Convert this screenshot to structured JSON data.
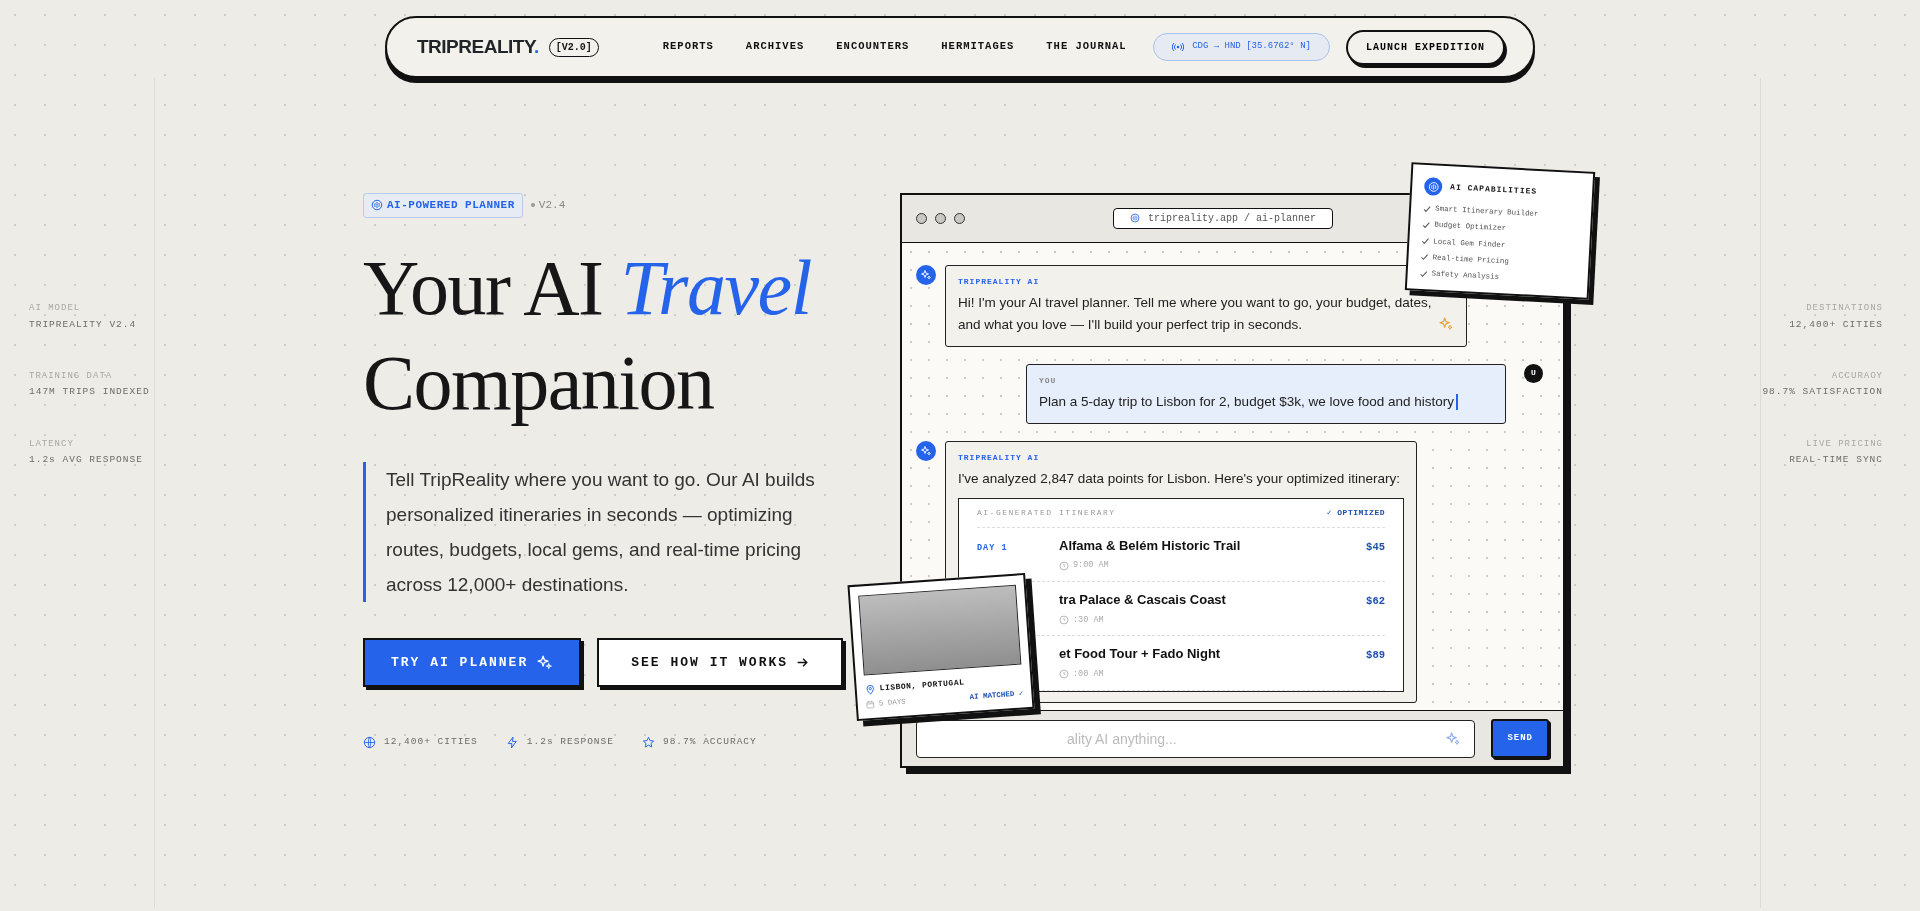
{
  "nav": {
    "brand": "TRIPREALITY",
    "brand_dot": ".",
    "version": "[V2.0]",
    "links": [
      "REPORTS",
      "ARCHIVES",
      "ENCOUNTERS",
      "HERMITAGES",
      "THE JOURNAL"
    ],
    "route": "CDG → HND [35.6762° N]",
    "cta": "LAUNCH EXPEDITION"
  },
  "side_left": [
    {
      "label": "AI MODEL",
      "value": "TRIPREALITY V2.4"
    },
    {
      "label": "TRAINING DATA",
      "value": "147M TRIPS INDEXED"
    },
    {
      "label": "LATENCY",
      "value": "1.2s AVG RESPONSE"
    }
  ],
  "side_right": [
    {
      "label": "DESTINATIONS",
      "value": "12,400+ CITIES"
    },
    {
      "label": "ACCURACY",
      "value": "98.7% SATISFACTION"
    },
    {
      "label": "LIVE PRICING",
      "value": "REAL-TIME SYNC"
    }
  ],
  "hero": {
    "badge": "AI-POWERED PLANNER",
    "version": "V2.4",
    "title_start": "Your AI",
    "title_accent": "Travel",
    "title_end": "Companion",
    "description": "Tell TripReality where you want to go. Our AI builds personalized itineraries in seconds — optimizing routes, budgets, local gems, and real-time pricing across 12,000+ destinations.",
    "primary_button": "TRY AI PLANNER",
    "secondary_button": "SEE HOW IT WORKS",
    "stats": [
      {
        "kind": "globe",
        "text": "12,400+ CITIES"
      },
      {
        "kind": "bolt",
        "text": "1.2s RESPONSE"
      },
      {
        "kind": "star",
        "text": "98.7% ACCURACY"
      }
    ]
  },
  "chat": {
    "url": "tripreality.app / ai-planner",
    "messages": [
      {
        "kind": "ai",
        "sender": "TRIPREALITY AI",
        "text": "Hi! I'm your AI travel planner. Tell me where you want to go, your budget, dates, and what you love — I'll build your perfect trip in seconds."
      },
      {
        "kind": "user",
        "sender": "YOU",
        "text": "Plan a 5-day trip to Lisbon for 2, budget $3k, we love food and history",
        "avatar": "U"
      },
      {
        "kind": "ai",
        "sender": "TRIPREALITY AI",
        "text": "I've analyzed 2,847 data points for Lisbon. Here's your optimized itinerary:",
        "itinerary": {
          "title": "AI-GENERATED ITINERARY",
          "status": "✓ OPTIMIZED",
          "items": [
            {
              "day": "DAY 1",
              "title": "Alfama & Belém Historic Trail",
              "time": "9:00 AM",
              "price": "$45"
            },
            {
              "title": "tra Palace & Cascais Coast",
              "time": ":30 AM",
              "price": "$62"
            },
            {
              "title": "et Food Tour + Fado Night",
              "time": ":00 AM",
              "price": "$89"
            }
          ]
        }
      }
    ],
    "input": {
      "placeholder": "ality AI anything..."
    },
    "send": "SEND"
  },
  "capabilities": {
    "title": "AI CAPABILITIES",
    "items": [
      "Smart Itinerary Builder",
      "Budget Optimizer",
      "Local Gem Finder",
      "Real-time Pricing",
      "Safety Analysis"
    ]
  },
  "photo_card": {
    "location": "LISBON, PORTUGAL",
    "duration": "5 DAYS",
    "match": "AI MATCHED ✓"
  }
}
